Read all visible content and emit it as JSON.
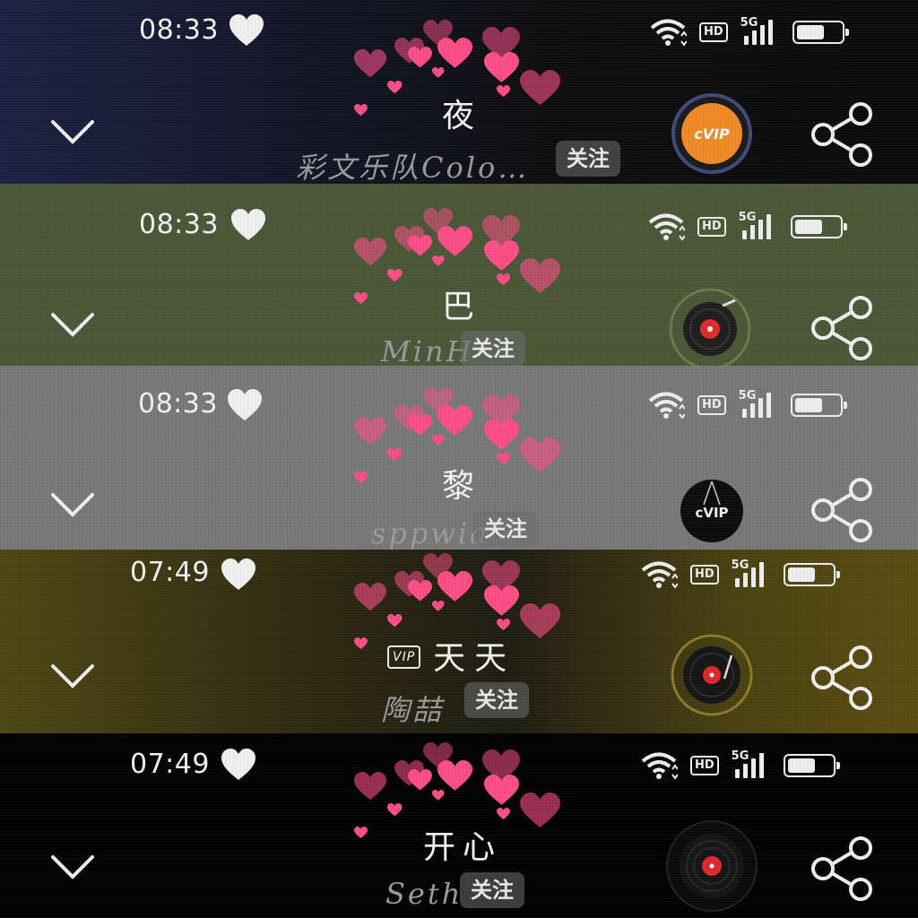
{
  "panels": [
    {
      "time": "08:33",
      "title": "夜",
      "vip": "",
      "artist": "彩文乐队Colo…",
      "follow": "关注",
      "disc": "vip-orange-disc"
    },
    {
      "time": "08:33",
      "title": "巴",
      "vip": "",
      "artist": "MinH",
      "follow": "关注",
      "disc": "vinyl-record-disc"
    },
    {
      "time": "08:33",
      "title": "黎",
      "vip": "",
      "artist": "sppwia",
      "follow": "关注",
      "disc": "vip-black-disc"
    },
    {
      "time": "07:49",
      "title": "天天",
      "vip": "VIP",
      "artist": "陶喆",
      "follow": "关注",
      "disc": "vinyl-red-disc"
    },
    {
      "time": "07:49",
      "title": "开心",
      "vip": "",
      "artist": "Seth",
      "follow": "关注",
      "disc": "vinyl-red-disc"
    }
  ],
  "status": {
    "hd": "HD",
    "network": "5G"
  },
  "colors": {
    "panel1": "#141a33",
    "panel2": "#4b5a38",
    "panel3": "#777777",
    "panel4": "#4a4110",
    "panel5": "#000000",
    "heart": "#ff4d88",
    "follow_bg": "#6e6e6e"
  }
}
